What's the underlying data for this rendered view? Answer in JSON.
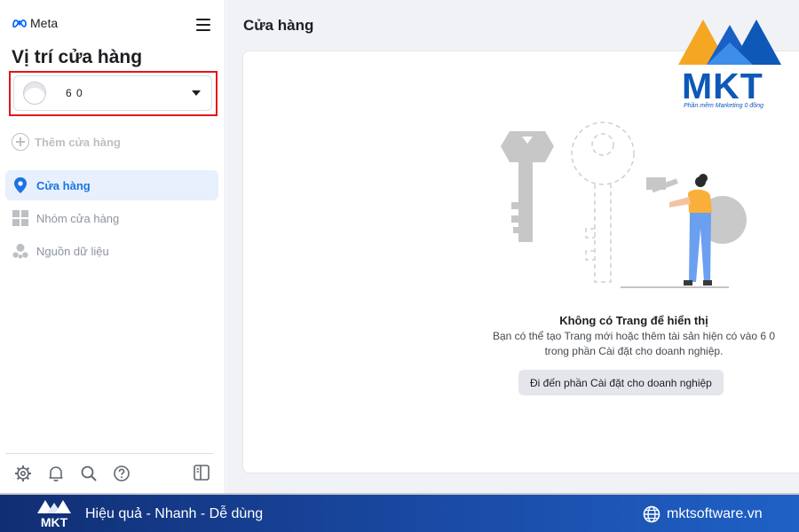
{
  "sidebar": {
    "brand": "Meta",
    "title": "Vị trí cửa hàng",
    "selector_value": "6 0",
    "add_store_label": "Thêm cửa hàng",
    "nav": [
      {
        "label": "Cửa hàng",
        "icon": "location-pin-icon",
        "active": true
      },
      {
        "label": "Nhóm cửa hàng",
        "icon": "grid-icon",
        "active": false
      },
      {
        "label": "Nguồn dữ liệu",
        "icon": "data-source-icon",
        "active": false
      }
    ],
    "bottom_icons": [
      "settings-icon",
      "bell-icon",
      "search-icon",
      "help-icon",
      "panel-toggle-icon"
    ]
  },
  "main": {
    "title": "Cửa hàng",
    "empty_title": "Không có Trang để hiển thị",
    "empty_desc_line1": "Bạn có thể tạo Trang mới hoặc thêm tài sản hiện có vào 6 0",
    "empty_desc_line2": "trong phần Cài đặt cho doanh nghiệp.",
    "button_label": "Đi đến phần Cài đặt cho doanh nghiệp"
  },
  "watermark": {
    "logo_text": "MKT",
    "logo_subtext": "Phần mềm Marketing 0 đồng"
  },
  "footer": {
    "tagline": "Hiệu quả - Nhanh - Dễ dùng",
    "website": "mktsoftware.vn",
    "logo_text": "MKT"
  },
  "colors": {
    "accent": "#1b74e4",
    "highlight_border": "#e0171d",
    "footer_start": "#102e73",
    "footer_end": "#1f61c6",
    "logo_blue": "#0e58b8",
    "logo_orange": "#f5a623"
  }
}
